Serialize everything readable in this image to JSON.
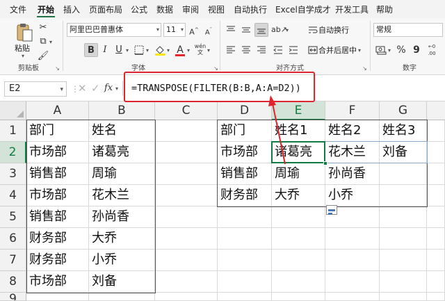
{
  "ribbon_tabs": [
    "文件",
    "开始",
    "插入",
    "页面布局",
    "公式",
    "数据",
    "审阅",
    "视图",
    "自动执行",
    "Excel自学成才",
    "开发工具",
    "帮助"
  ],
  "active_tab": "开始",
  "clipboard": {
    "paste_label": "粘贴",
    "group_label": "剪贴板"
  },
  "font": {
    "name": "阿里巴巴普惠体",
    "size": "11",
    "group_label": "字体",
    "bold": "B",
    "italic": "I",
    "underline": "U",
    "font_color_glyph": "A",
    "wen_glyph": "wén",
    "font_color": "#e8262a",
    "fill_color": "#ffe600"
  },
  "alignment": {
    "wrap_label": "自动换行",
    "merge_label": "合并后居中",
    "group_label": "对齐方式"
  },
  "number": {
    "format": "常规",
    "group_label": "数字",
    "percent": "%",
    "comma": "9",
    "inc_decimal": "←0 .00",
    "dec_decimal": ".00 →0"
  },
  "name_box": "E2",
  "formula": "=TRANSPOSE(FILTER(B:B,A:A=D2))",
  "fx_label": "fx",
  "columns": [
    "A",
    "B",
    "C",
    "D",
    "E",
    "F",
    "G"
  ],
  "selected_column": "E",
  "rows": [
    "1",
    "2",
    "3",
    "4",
    "5",
    "6",
    "7",
    "8",
    "9"
  ],
  "selected_row": "2",
  "source_table": [
    [
      "部门",
      "姓名"
    ],
    [
      "市场部",
      "诸葛亮"
    ],
    [
      "销售部",
      "周瑜"
    ],
    [
      "市场部",
      "花木兰"
    ],
    [
      "销售部",
      "孙尚香"
    ],
    [
      "财务部",
      "大乔"
    ],
    [
      "财务部",
      "小乔"
    ],
    [
      "市场部",
      "刘备"
    ]
  ],
  "result_table": [
    [
      "部门",
      "姓名1",
      "姓名2",
      "姓名3"
    ],
    [
      "市场部",
      "诸葛亮",
      "花木兰",
      "刘备"
    ],
    [
      "销售部",
      "周瑜",
      "孙尚香",
      ""
    ],
    [
      "财务部",
      "大乔",
      "小乔",
      ""
    ]
  ],
  "colors": {
    "accent": "#107c41",
    "annotation_red": "#e0242f"
  }
}
